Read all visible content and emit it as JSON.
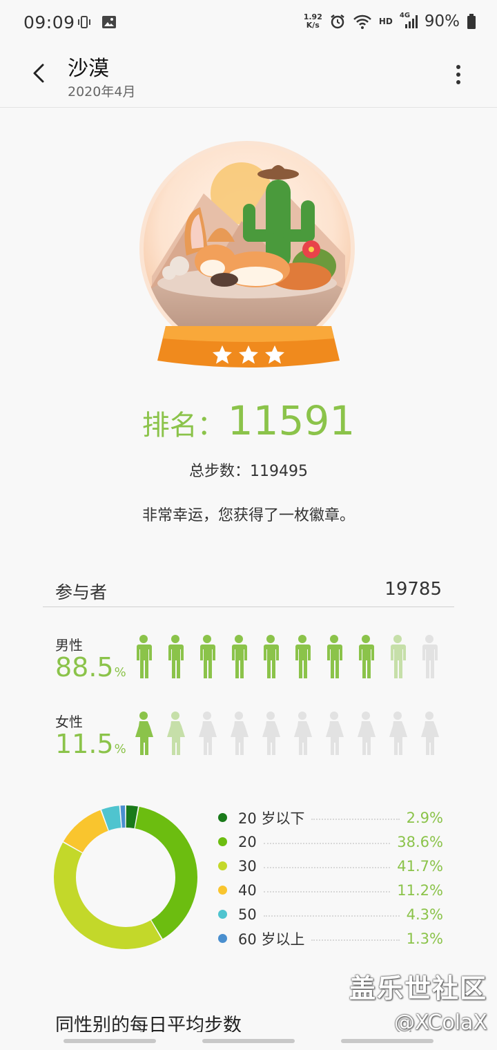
{
  "status_bar": {
    "time": "09:09",
    "net_speed_value": "1.92",
    "net_speed_unit": "K/s",
    "network": "HD",
    "signal": "4G",
    "battery": "90%"
  },
  "header": {
    "title": "沙漠",
    "subtitle": "2020年4月"
  },
  "badge": {
    "stars": 3,
    "accent_color": "#f5a021"
  },
  "rank": {
    "label": "排名：",
    "value": "11591"
  },
  "total_steps": "总步数：119495",
  "message": "非常幸运，您获得了一枚徽章。",
  "participants": {
    "label": "参与者",
    "count": "19785"
  },
  "gender": {
    "male": {
      "label": "男性",
      "percent": "88.5",
      "unit": "%",
      "share": 0.885,
      "icon": "male-person-icon"
    },
    "female": {
      "label": "女性",
      "percent": "11.5",
      "unit": "%",
      "share": 0.115,
      "icon": "female-person-icon"
    },
    "icons_per_row": 10
  },
  "chart_data": {
    "type": "pie",
    "donut": true,
    "categories": [
      "20 岁以下",
      "20",
      "30",
      "40",
      "50",
      "60 岁以上"
    ],
    "values": [
      2.9,
      38.6,
      41.7,
      11.2,
      4.3,
      1.3
    ],
    "labels": [
      "2.9%",
      "38.6%",
      "41.7%",
      "11.2%",
      "4.3%",
      "1.3%"
    ],
    "colors": [
      "#1a7a1a",
      "#6cbd10",
      "#c3d82a",
      "#f9c52e",
      "#4fc4cf",
      "#4a8fcf"
    ],
    "legend_position": "right"
  },
  "section": {
    "title": "同性别的每日平均步数"
  },
  "watermark": {
    "line1": "盖乐世社区",
    "line2": "@XColaX"
  },
  "colors": {
    "accent": "#8bc34a",
    "male_icon": "#8bc34a",
    "female_icon": "#8bc34a",
    "inactive_icon": "#e2e2e2"
  }
}
